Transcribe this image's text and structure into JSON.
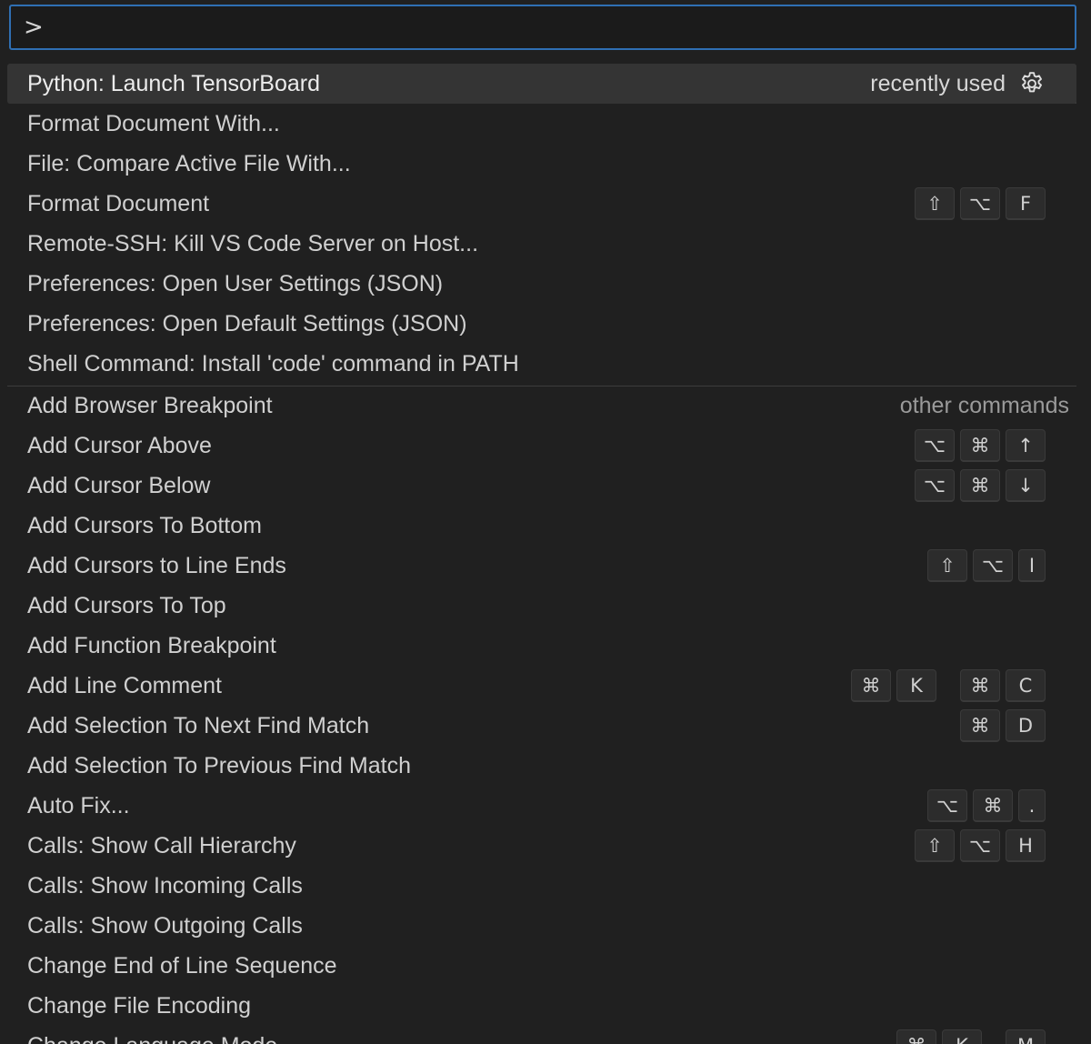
{
  "search": {
    "value": ">"
  },
  "labels": {
    "recently_used": "recently used",
    "other_commands": "other commands"
  },
  "icons": {
    "gear": "gear-icon"
  },
  "colors": {
    "focus_border": "#2f6fb3",
    "selection": "#343434"
  },
  "recent": [
    {
      "label": "Python: Launch TensorBoard"
    },
    {
      "label": "Format Document With..."
    },
    {
      "label": "File: Compare Active File With..."
    },
    {
      "label": "Format Document",
      "keys": [
        [
          "⇧",
          "⌥",
          "F"
        ]
      ]
    },
    {
      "label": "Remote-SSH: Kill VS Code Server on Host..."
    },
    {
      "label": "Preferences: Open User Settings (JSON)"
    },
    {
      "label": "Preferences: Open Default Settings (JSON)"
    },
    {
      "label": "Shell Command: Install 'code' command in PATH"
    }
  ],
  "other": [
    {
      "label": "Add Browser Breakpoint"
    },
    {
      "label": "Add Cursor Above",
      "keys": [
        [
          "⌥",
          "⌘",
          "↑"
        ]
      ]
    },
    {
      "label": "Add Cursor Below",
      "keys": [
        [
          "⌥",
          "⌘",
          "↓"
        ]
      ]
    },
    {
      "label": "Add Cursors To Bottom"
    },
    {
      "label": "Add Cursors to Line Ends",
      "keys": [
        [
          "⇧",
          "⌥",
          "I"
        ]
      ]
    },
    {
      "label": "Add Cursors To Top"
    },
    {
      "label": "Add Function Breakpoint"
    },
    {
      "label": "Add Line Comment",
      "keys": [
        [
          "⌘",
          "K"
        ],
        [
          "⌘",
          "C"
        ]
      ]
    },
    {
      "label": "Add Selection To Next Find Match",
      "keys": [
        [
          "⌘",
          "D"
        ]
      ]
    },
    {
      "label": "Add Selection To Previous Find Match"
    },
    {
      "label": "Auto Fix...",
      "keys": [
        [
          "⌥",
          "⌘",
          "."
        ]
      ]
    },
    {
      "label": "Calls: Show Call Hierarchy",
      "keys": [
        [
          "⇧",
          "⌥",
          "H"
        ]
      ]
    },
    {
      "label": "Calls: Show Incoming Calls"
    },
    {
      "label": "Calls: Show Outgoing Calls"
    },
    {
      "label": "Change End of Line Sequence"
    },
    {
      "label": "Change File Encoding"
    },
    {
      "label": "Change Language Mode",
      "keys": [
        [
          "⌘",
          "K"
        ],
        [
          "M"
        ]
      ]
    }
  ]
}
